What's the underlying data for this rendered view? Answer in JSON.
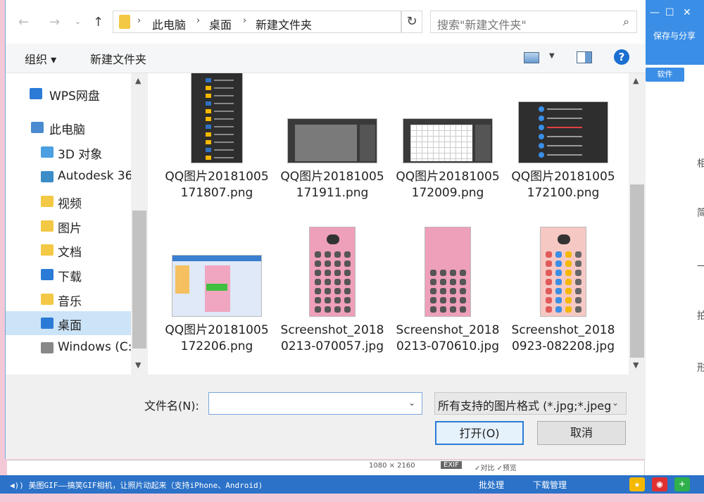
{
  "dialog": {
    "address": {
      "crumbs": [
        "此电脑",
        "桌面",
        "新建文件夹"
      ]
    },
    "search_placeholder": "搜索\"新建文件夹\"",
    "toolbar": {
      "organize_label": "组织 ▾",
      "new_folder_label": "新建文件夹"
    },
    "nav_items": [
      {
        "label": "WPS网盘",
        "icon": "cloud-icon",
        "color": "#2b7bd6"
      },
      {
        "label": "此电脑",
        "icon": "computer-icon",
        "color": "#4a8ad0"
      },
      {
        "label": "3D 对象",
        "icon": "3d-objects-icon",
        "color": "#4aa0e0"
      },
      {
        "label": "Autodesk 36",
        "icon": "autodesk-icon",
        "color": "#3c8cc8"
      },
      {
        "label": "视频",
        "icon": "video-folder-icon",
        "color": "#f3c844"
      },
      {
        "label": "图片",
        "icon": "pictures-folder-icon",
        "color": "#f3c844"
      },
      {
        "label": "文档",
        "icon": "documents-folder-icon",
        "color": "#f3c844"
      },
      {
        "label": "下载",
        "icon": "downloads-folder-icon",
        "color": "#2b7bd6"
      },
      {
        "label": "音乐",
        "icon": "music-folder-icon",
        "color": "#f3c844"
      },
      {
        "label": "桌面",
        "icon": "desktop-folder-icon",
        "color": "#2b7bd6"
      },
      {
        "label": "Windows (C:",
        "icon": "drive-icon",
        "color": "#888888"
      }
    ],
    "files": [
      {
        "name": "QQ图片20181005171807.png",
        "thumb": "dark-menu"
      },
      {
        "name": "QQ图片20181005171911.png",
        "thumb": "ps-gray"
      },
      {
        "name": "QQ图片20181005172009.png",
        "thumb": "ps-grid"
      },
      {
        "name": "QQ图片20181005172100.png",
        "thumb": "dark-menu-2"
      },
      {
        "name": "QQ图片20181005172206.png",
        "thumb": "blue-app"
      },
      {
        "name": "Screenshot_20180213-070057.jpg",
        "thumb": "pink-phone"
      },
      {
        "name": "Screenshot_20180213-070610.jpg",
        "thumb": "pink-phone-2"
      },
      {
        "name": "Screenshot_20180923-082208.jpg",
        "thumb": "pink-phone-3"
      }
    ],
    "filename_label": "文件名(N):",
    "filename_value": "",
    "filetype_value": "所有支持的图片格式 (*.jpg;*.jpeg",
    "open_label": "打开(O)",
    "cancel_label": "取消"
  },
  "background_app": {
    "save_share_label": "保存与分享",
    "software_label": "软件",
    "side_chars": [
      "相",
      "简",
      "一",
      "拍",
      "形"
    ],
    "dims_text": "1080 × 2160",
    "exif_label": "EXIF",
    "stats_text": "✓对比  ✓预览",
    "status_text": "◀)) 美图GIF——搞笑GIF相机，让照片动起来（支持iPhone、Android)",
    "batch_label": "批处理",
    "download_label": "下载管理",
    "tray_colors": [
      "#f5b800",
      "#e03030",
      "#2fb04a"
    ]
  }
}
